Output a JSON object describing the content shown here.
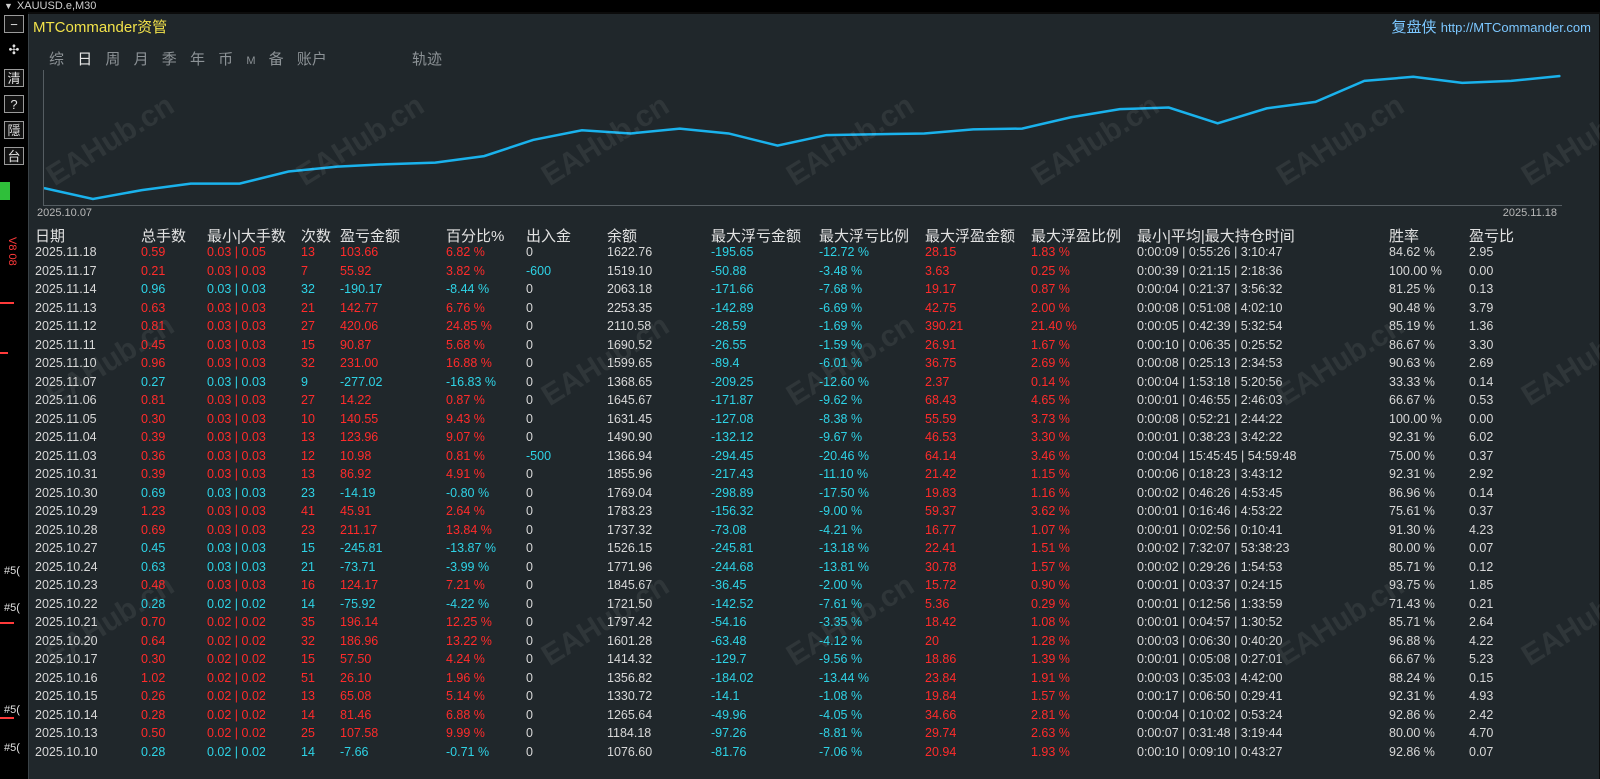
{
  "window": {
    "symbol_title": "XAUUSD.e,M30"
  },
  "toolbar": {
    "btn_minimize": "−",
    "btn_move": "✣",
    "btn_clear": "清",
    "btn_help": "?",
    "btn_hide": "隱",
    "btn_restore": "台"
  },
  "side": {
    "level_label": "V8 08",
    "order_tag": "#5("
  },
  "brand": {
    "title": "MTCommander资管",
    "right_cn": "复盘侠",
    "right_url": "http://MTCommander.com"
  },
  "tabs": [
    {
      "label": "综"
    },
    {
      "label": "日"
    },
    {
      "label": "周"
    },
    {
      "label": "月"
    },
    {
      "label": "季"
    },
    {
      "label": "年"
    },
    {
      "label": "币"
    },
    {
      "label": "M"
    },
    {
      "label": "备"
    },
    {
      "label": "账户"
    },
    {
      "label": "轨迹"
    }
  ],
  "active_tab": "日",
  "watermark": "EAHub.cn",
  "chart_data": {
    "type": "line",
    "x_start": "2025.10.07",
    "x_end": "2025.11.18",
    "color": "#1ab2ec",
    "values": [
      1065,
      1038,
      1060,
      1076,
      1076,
      1106,
      1118,
      1124,
      1128,
      1144,
      1184,
      1208,
      1200,
      1212,
      1200,
      1170,
      1196,
      1198,
      1200,
      1210,
      1212,
      1240,
      1260,
      1264,
      1225,
      1262,
      1278,
      1330,
      1340,
      1325,
      1330,
      1342
    ]
  },
  "table": {
    "headers": [
      "日期",
      "总手数",
      "最小|大手数",
      "次数",
      "盈亏金额",
      "百分比%",
      "出入金",
      "余额",
      "最大浮亏金额",
      "最大浮亏比例",
      "最大浮盈金额",
      "最大浮盈比例",
      "最小|平均|最大持仓时间",
      "胜率",
      "盈亏比"
    ],
    "rows": [
      [
        "2025.11.18",
        "0.59",
        "0.03 | 0.05",
        "13",
        "103.66",
        "6.82 %",
        "0",
        "1622.76",
        "-195.65",
        "-12.72 %",
        "28.15",
        "1.83 %",
        "0:00:09 | 0:55:26 | 3:10:47",
        "84.62 %",
        "2.95"
      ],
      [
        "2025.11.17",
        "0.21",
        "0.03 | 0.03",
        "7",
        "55.92",
        "3.82 %",
        "-600",
        "1519.10",
        "-50.88",
        "-3.48 %",
        "3.63",
        "0.25 %",
        "0:00:39 | 0:21:15 | 2:18:36",
        "100.00 %",
        "0.00"
      ],
      [
        "2025.11.14",
        "0.96",
        "0.03 | 0.03",
        "32",
        "-190.17",
        "-8.44 %",
        "0",
        "2063.18",
        "-171.66",
        "-7.68 %",
        "19.17",
        "0.87 %",
        "0:00:04 | 0:21:37 | 3:56:32",
        "81.25 %",
        "0.13"
      ],
      [
        "2025.11.13",
        "0.63",
        "0.03 | 0.03",
        "21",
        "142.77",
        "6.76 %",
        "0",
        "2253.35",
        "-142.89",
        "-6.69 %",
        "42.75",
        "2.00 %",
        "0:00:08 | 0:51:08 | 4:02:10",
        "90.48 %",
        "3.79"
      ],
      [
        "2025.11.12",
        "0.81",
        "0.03 | 0.03",
        "27",
        "420.06",
        "24.85 %",
        "0",
        "2110.58",
        "-28.59",
        "-1.69 %",
        "390.21",
        "21.40 %",
        "0:00:05 | 0:42:39 | 5:32:54",
        "85.19 %",
        "1.36"
      ],
      [
        "2025.11.11",
        "0.45",
        "0.03 | 0.03",
        "15",
        "90.87",
        "5.68 %",
        "0",
        "1690.52",
        "-26.55",
        "-1.59 %",
        "26.91",
        "1.67 %",
        "0:00:10 | 0:06:35 | 0:25:52",
        "86.67 %",
        "3.30"
      ],
      [
        "2025.11.10",
        "0.96",
        "0.03 | 0.03",
        "32",
        "231.00",
        "16.88 %",
        "0",
        "1599.65",
        "-89.4",
        "-6.01 %",
        "36.75",
        "2.69 %",
        "0:00:08 | 0:25:13 | 2:34:53",
        "90.63 %",
        "2.69"
      ],
      [
        "2025.11.07",
        "0.27",
        "0.03 | 0.03",
        "9",
        "-277.02",
        "-16.83 %",
        "0",
        "1368.65",
        "-209.25",
        "-12.60 %",
        "2.37",
        "0.14 %",
        "0:00:04 | 1:53:18 | 5:20:56",
        "33.33 %",
        "0.14"
      ],
      [
        "2025.11.06",
        "0.81",
        "0.03 | 0.03",
        "27",
        "14.22",
        "0.87 %",
        "0",
        "1645.67",
        "-171.87",
        "-9.62 %",
        "68.43",
        "4.65 %",
        "0:00:01 | 0:46:55 | 2:46:03",
        "66.67 %",
        "0.53"
      ],
      [
        "2025.11.05",
        "0.30",
        "0.03 | 0.03",
        "10",
        "140.55",
        "9.43 %",
        "0",
        "1631.45",
        "-127.08",
        "-8.38 %",
        "55.59",
        "3.73 %",
        "0:00:08 | 0:52:21 | 2:44:22",
        "100.00 %",
        "0.00"
      ],
      [
        "2025.11.04",
        "0.39",
        "0.03 | 0.03",
        "13",
        "123.96",
        "9.07 %",
        "0",
        "1490.90",
        "-132.12",
        "-9.67 %",
        "46.53",
        "3.30 %",
        "0:00:01 | 0:38:23 | 3:42:22",
        "92.31 %",
        "6.02"
      ],
      [
        "2025.11.03",
        "0.36",
        "0.03 | 0.03",
        "12",
        "10.98",
        "0.81 %",
        "-500",
        "1366.94",
        "-294.45",
        "-20.46 %",
        "64.14",
        "3.46 %",
        "0:00:04 | 15:45:45 | 54:59:48",
        "75.00 %",
        "0.37"
      ],
      [
        "2025.10.31",
        "0.39",
        "0.03 | 0.03",
        "13",
        "86.92",
        "4.91 %",
        "0",
        "1855.96",
        "-217.43",
        "-11.10 %",
        "21.42",
        "1.15 %",
        "0:00:06 | 0:18:23 | 3:43:12",
        "92.31 %",
        "2.92"
      ],
      [
        "2025.10.30",
        "0.69",
        "0.03 | 0.03",
        "23",
        "-14.19",
        "-0.80 %",
        "0",
        "1769.04",
        "-298.89",
        "-17.50 %",
        "19.83",
        "1.16 %",
        "0:00:02 | 0:46:26 | 4:53:45",
        "86.96 %",
        "0.14"
      ],
      [
        "2025.10.29",
        "1.23",
        "0.03 | 0.03",
        "41",
        "45.91",
        "2.64 %",
        "0",
        "1783.23",
        "-156.32",
        "-9.00 %",
        "59.37",
        "3.62 %",
        "0:00:01 | 0:16:46 | 4:53:22",
        "75.61 %",
        "0.37"
      ],
      [
        "2025.10.28",
        "0.69",
        "0.03 | 0.03",
        "23",
        "211.17",
        "13.84 %",
        "0",
        "1737.32",
        "-73.08",
        "-4.21 %",
        "16.77",
        "1.07 %",
        "0:00:01 | 0:02:56 | 0:10:41",
        "91.30 %",
        "4.23"
      ],
      [
        "2025.10.27",
        "0.45",
        "0.03 | 0.03",
        "15",
        "-245.81",
        "-13.87 %",
        "0",
        "1526.15",
        "-245.81",
        "-13.18 %",
        "22.41",
        "1.51 %",
        "0:00:02 | 7:32:07 | 53:38:23",
        "80.00 %",
        "0.07"
      ],
      [
        "2025.10.24",
        "0.63",
        "0.03 | 0.03",
        "21",
        "-73.71",
        "-3.99 %",
        "0",
        "1771.96",
        "-244.68",
        "-13.81 %",
        "30.78",
        "1.57 %",
        "0:00:02 | 0:29:26 | 1:54:53",
        "85.71 %",
        "0.12"
      ],
      [
        "2025.10.23",
        "0.48",
        "0.03 | 0.03",
        "16",
        "124.17",
        "7.21 %",
        "0",
        "1845.67",
        "-36.45",
        "-2.00 %",
        "15.72",
        "0.90 %",
        "0:00:01 | 0:03:37 | 0:24:15",
        "93.75 %",
        "1.85"
      ],
      [
        "2025.10.22",
        "0.28",
        "0.02 | 0.02",
        "14",
        "-75.92",
        "-4.22 %",
        "0",
        "1721.50",
        "-142.52",
        "-7.61 %",
        "5.36",
        "0.29 %",
        "0:00:01 | 0:12:56 | 1:33:59",
        "71.43 %",
        "0.21"
      ],
      [
        "2025.10.21",
        "0.70",
        "0.02 | 0.02",
        "35",
        "196.14",
        "12.25 %",
        "0",
        "1797.42",
        "-54.16",
        "-3.35 %",
        "18.42",
        "1.08 %",
        "0:00:01 | 0:04:57 | 1:30:52",
        "85.71 %",
        "2.64"
      ],
      [
        "2025.10.20",
        "0.64",
        "0.02 | 0.02",
        "32",
        "186.96",
        "13.22 %",
        "0",
        "1601.28",
        "-63.48",
        "-4.12 %",
        "20",
        "1.28 %",
        "0:00:03 | 0:06:30 | 0:40:20",
        "96.88 %",
        "4.22"
      ],
      [
        "2025.10.17",
        "0.30",
        "0.02 | 0.02",
        "15",
        "57.50",
        "4.24 %",
        "0",
        "1414.32",
        "-129.7",
        "-9.56 %",
        "18.86",
        "1.39 %",
        "0:00:01 | 0:05:08 | 0:27:01",
        "66.67 %",
        "5.23"
      ],
      [
        "2025.10.16",
        "1.02",
        "0.02 | 0.02",
        "51",
        "26.10",
        "1.96 %",
        "0",
        "1356.82",
        "-184.02",
        "-13.44 %",
        "23.84",
        "1.91 %",
        "0:00:03 | 0:35:03 | 4:42:00",
        "88.24 %",
        "0.15"
      ],
      [
        "2025.10.15",
        "0.26",
        "0.02 | 0.02",
        "13",
        "65.08",
        "5.14 %",
        "0",
        "1330.72",
        "-14.1",
        "-1.08 %",
        "19.84",
        "1.57 %",
        "0:00:17 | 0:06:50 | 0:29:41",
        "92.31 %",
        "4.93"
      ],
      [
        "2025.10.14",
        "0.28",
        "0.02 | 0.02",
        "14",
        "81.46",
        "6.88 %",
        "0",
        "1265.64",
        "-49.96",
        "-4.05 %",
        "34.66",
        "2.81 %",
        "0:00:04 | 0:10:02 | 0:53:24",
        "92.86 %",
        "2.42"
      ],
      [
        "2025.10.13",
        "0.50",
        "0.02 | 0.02",
        "25",
        "107.58",
        "9.99 %",
        "0",
        "1184.18",
        "-97.26",
        "-8.81 %",
        "29.74",
        "2.63 %",
        "0:00:07 | 0:31:48 | 3:19:44",
        "80.00 %",
        "4.70"
      ],
      [
        "2025.10.10",
        "0.28",
        "0.02 | 0.02",
        "14",
        "-7.66",
        "-0.71 %",
        "0",
        "1076.60",
        "-81.76",
        "-7.06 %",
        "20.94",
        "1.93 %",
        "0:00:10 | 0:09:10 | 0:43:27",
        "92.86 %",
        "0.07"
      ]
    ]
  }
}
